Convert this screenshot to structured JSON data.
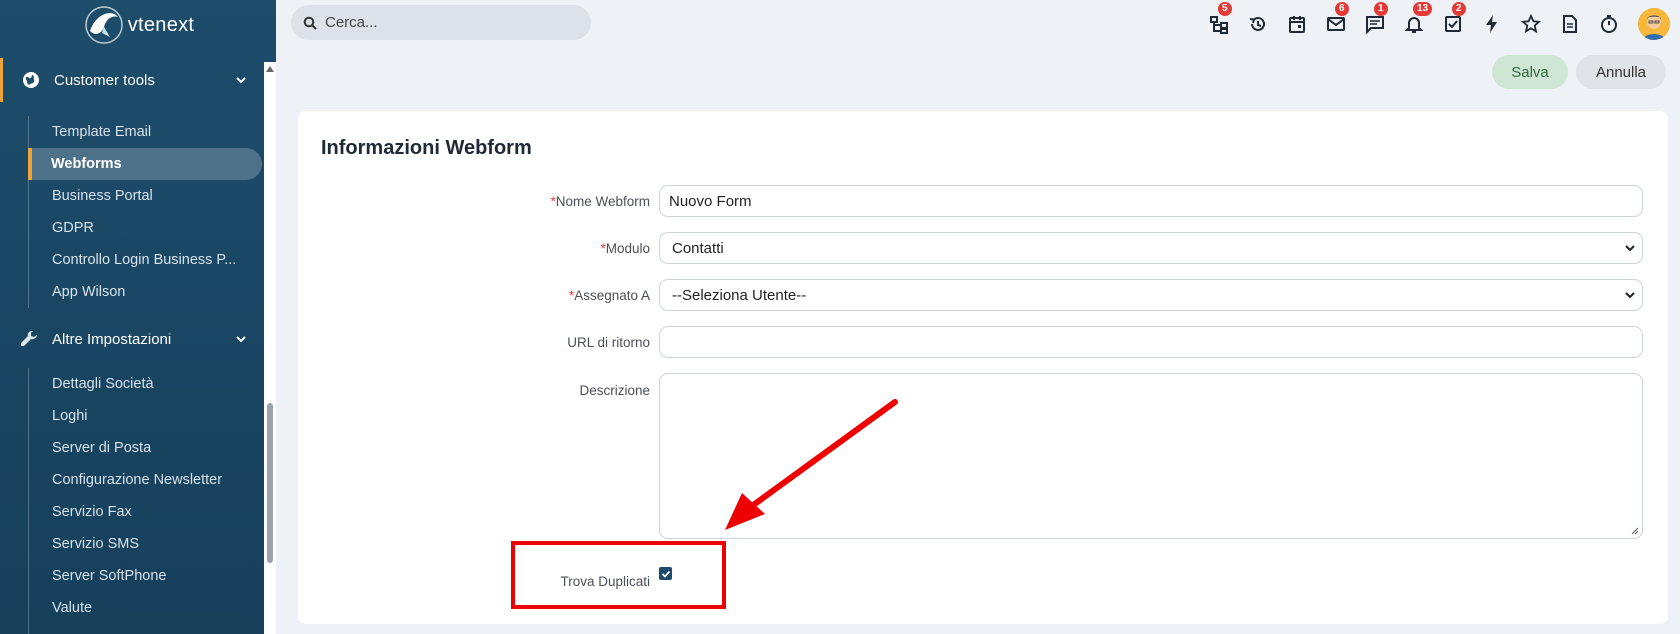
{
  "app": {
    "name": "vtenext"
  },
  "sidebar": {
    "section1": {
      "label": "Customer tools"
    },
    "section1_items": [
      {
        "label": "Template Email"
      },
      {
        "label": "Webforms"
      },
      {
        "label": "Business Portal"
      },
      {
        "label": "GDPR"
      },
      {
        "label": "Controllo Login Business P..."
      },
      {
        "label": "App Wilson"
      }
    ],
    "section2": {
      "label": "Altre Impostazioni"
    },
    "section2_items": [
      {
        "label": "Dettagli Società"
      },
      {
        "label": "Loghi"
      },
      {
        "label": "Server di Posta"
      },
      {
        "label": "Configurazione Newsletter"
      },
      {
        "label": "Servizio Fax"
      },
      {
        "label": "Servizio SMS"
      },
      {
        "label": "Server SoftPhone"
      },
      {
        "label": "Valute"
      }
    ]
  },
  "search": {
    "placeholder": "Cerca..."
  },
  "topbar": {
    "icons": [
      {
        "icon": "hierarchy-icon",
        "badge": "5"
      },
      {
        "icon": "history-icon",
        "badge": ""
      },
      {
        "icon": "calendar-icon",
        "badge": ""
      },
      {
        "icon": "mail-icon",
        "badge": "6"
      },
      {
        "icon": "chat-icon",
        "badge": "1"
      },
      {
        "icon": "bell-icon",
        "badge": "13"
      },
      {
        "icon": "tasks-icon",
        "badge": "2"
      },
      {
        "icon": "bolt-icon",
        "badge": ""
      },
      {
        "icon": "star-icon",
        "badge": ""
      },
      {
        "icon": "document-icon",
        "badge": ""
      },
      {
        "icon": "timer-icon",
        "badge": ""
      }
    ]
  },
  "actions": {
    "save": "Salva",
    "cancel": "Annulla"
  },
  "form": {
    "title": "Informazioni Webform",
    "required_mark": "*",
    "name": {
      "label": "Nome Webform",
      "value": "Nuovo Form"
    },
    "module": {
      "label": "Modulo",
      "value": "Contatti"
    },
    "assigned": {
      "label": "Assegnato A",
      "value": "--Seleziona Utente--"
    },
    "return_url": {
      "label": "URL di ritorno",
      "value": ""
    },
    "description": {
      "label": "Descrizione",
      "value": ""
    },
    "duplicates": {
      "label": "Trova Duplicati",
      "checked": true
    }
  },
  "colors": {
    "sidebar": "#1d4d6b",
    "accent": "#f2a23a",
    "badge": "#e53935",
    "save_bg": "#cfe6d5",
    "annotation": "#ee0000"
  }
}
